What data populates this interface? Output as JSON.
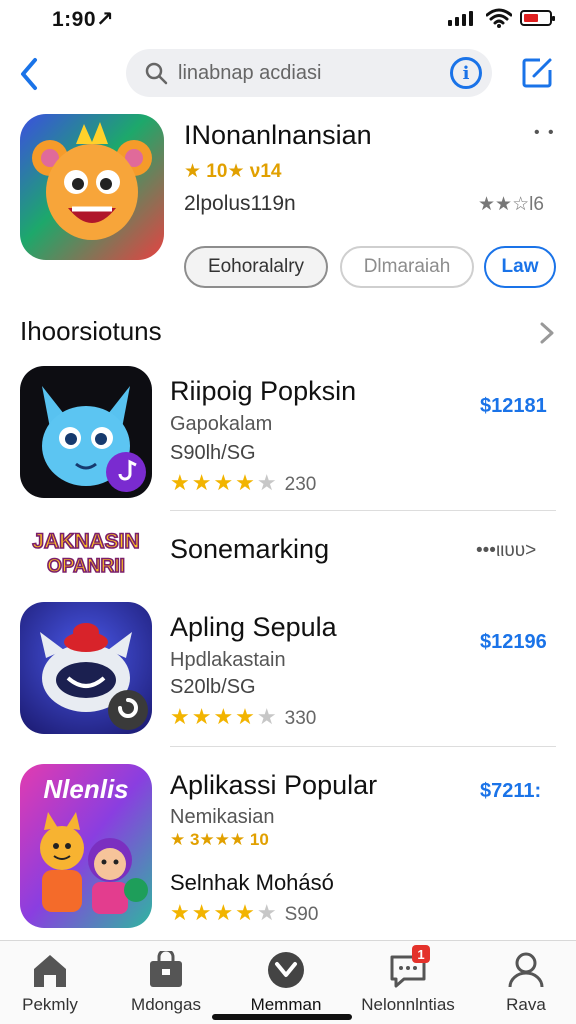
{
  "status": {
    "time": "1:90↗"
  },
  "search": {
    "placeholder": "linabnap acdiasi"
  },
  "featured": {
    "title": "INonanlnansian",
    "rating": "★ 10★ ν14",
    "subtitle": "2lpolus119n",
    "meta": "★★☆l6",
    "more": "• •",
    "buttons": [
      "Eohoralalry",
      "Dlmaraiah",
      "Law"
    ]
  },
  "section": {
    "title": "Ihoorsiotuns"
  },
  "apps": [
    {
      "name": "Riipoig Popksin",
      "developer": "Gapokalam",
      "size": "S90lh/SG",
      "price": "$12181",
      "stars": 4,
      "count": "230"
    },
    {
      "name": "Apling Sepula",
      "developer": "Hpdlakastain",
      "size": "S20lb/SG",
      "price": "$12196",
      "stars": 4,
      "count": "330"
    },
    {
      "name": "Aplikassi Popular",
      "developer": "Nemikasian",
      "rating_text": "★ 3★★★ 10",
      "size": "Selnhak Mohásó",
      "price": "$7211:",
      "stars": 4,
      "count": "S90"
    }
  ],
  "banner": {
    "logo_text": "JAKNASIN OPANRII",
    "title": "Sonemarking",
    "more": "•••ιιυυ>"
  },
  "tabs": [
    {
      "label": "Pekmly",
      "icon": "home-icon"
    },
    {
      "label": "Mdongas",
      "icon": "bag-icon"
    },
    {
      "label": "Memman",
      "icon": "compass-icon"
    },
    {
      "label": "Nelonnlntias",
      "icon": "chat-icon",
      "badge": "1"
    },
    {
      "label": "Rava",
      "icon": "person-icon"
    }
  ],
  "colors": {
    "accent": "#1a73e8",
    "star": "#f2b400",
    "badge": "#e4322b"
  }
}
